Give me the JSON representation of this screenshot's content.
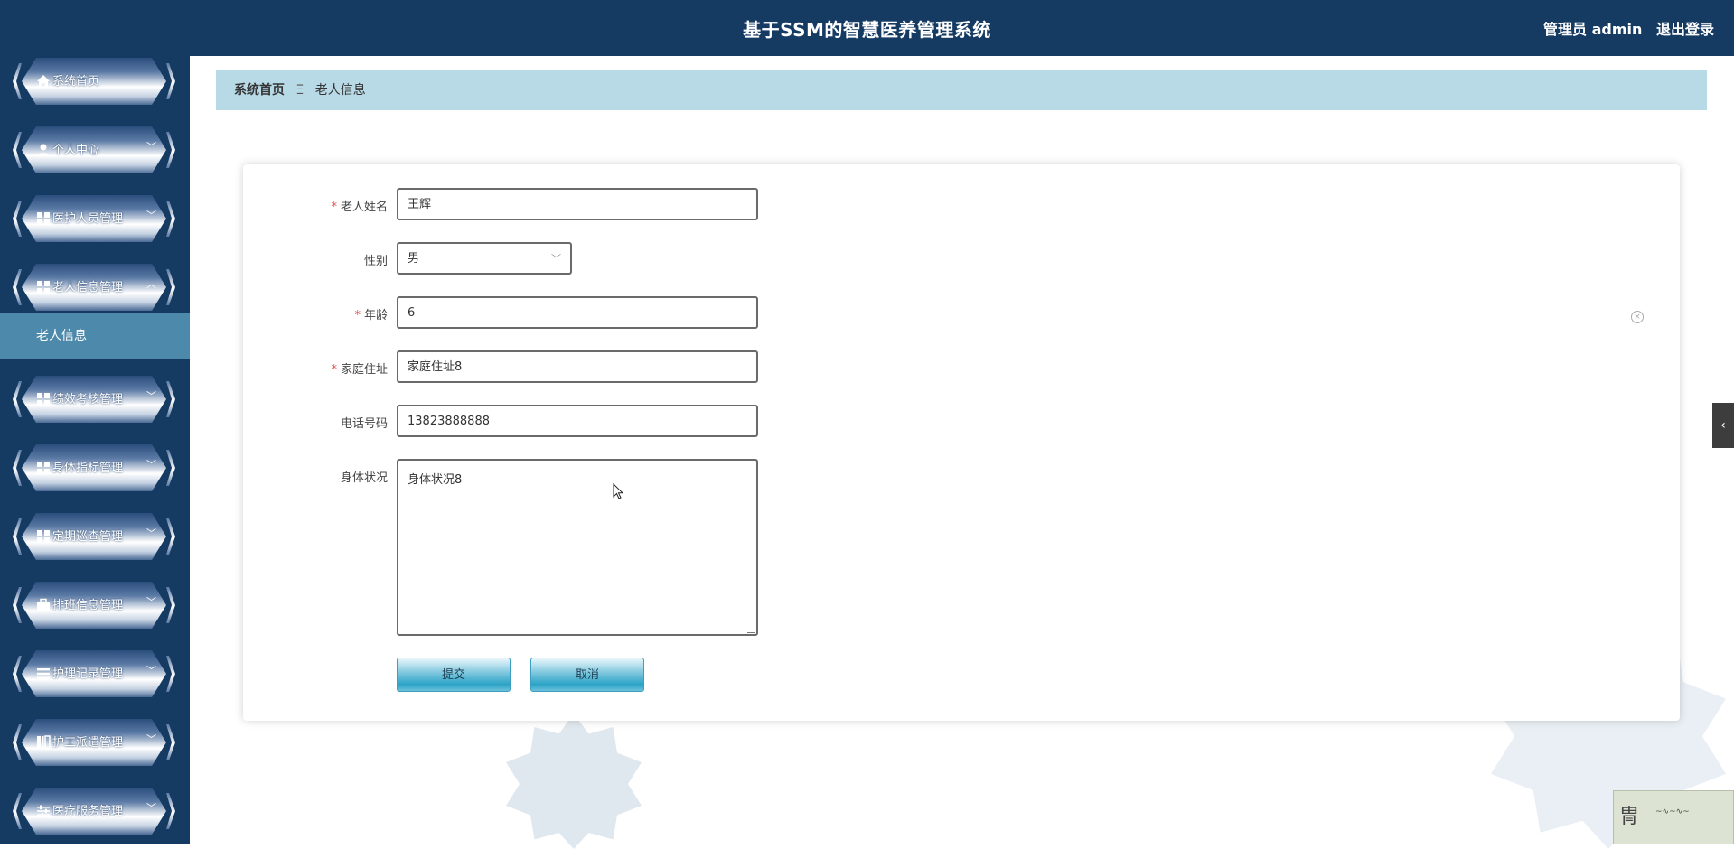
{
  "header": {
    "title": "基于SSM的智慧医养管理系统",
    "user_label": "管理员 admin",
    "logout_label": "退出登录"
  },
  "sidebar": {
    "items": [
      {
        "label": "系统首页",
        "icon": "home-icon"
      },
      {
        "label": "个人中心",
        "icon": "user-icon"
      },
      {
        "label": "医护人员管理",
        "icon": "grid-icon"
      },
      {
        "label": "老人信息管理",
        "icon": "grid-icon"
      },
      {
        "label": "绩效考核管理",
        "icon": "grid-icon"
      },
      {
        "label": "身体指标管理",
        "icon": "grid-icon"
      },
      {
        "label": "定期巡查管理",
        "icon": "grid-icon"
      },
      {
        "label": "排班信息管理",
        "icon": "briefcase-icon"
      },
      {
        "label": "护理记录管理",
        "icon": "list-icon"
      },
      {
        "label": "护工派遣管理",
        "icon": "columns-icon"
      },
      {
        "label": "医疗服务管理",
        "icon": "sliders-icon"
      }
    ],
    "active_sub_item": "老人信息"
  },
  "breadcrumb": {
    "home": "系统首页",
    "separator": "Ξ",
    "current": "老人信息"
  },
  "form": {
    "name_label": "老人姓名",
    "name_value": "王辉",
    "gender_label": "性别",
    "gender_value": "男",
    "age_label": "年龄",
    "age_value": "6",
    "address_label": "家庭住址",
    "address_value": "家庭住址8",
    "phone_label": "电话号码",
    "phone_value": "13823888888",
    "health_label": "身体状况",
    "health_value": "身体状况8",
    "required_mark": "*",
    "submit_label": "提交",
    "cancel_label": "取消"
  },
  "colors": {
    "header_bg": "#163b63",
    "sidebar_active": "#4d89aa",
    "breadcrumb_bg": "#b8d9e6",
    "required": "#e64a4a"
  }
}
